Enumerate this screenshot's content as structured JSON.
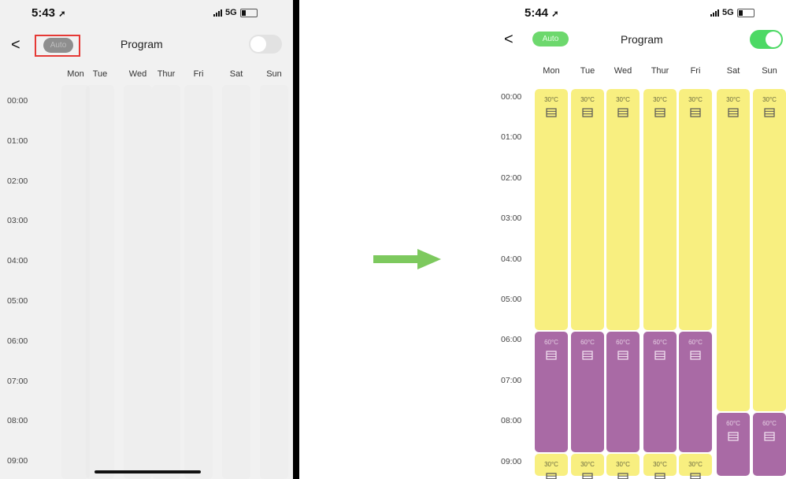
{
  "left_screen": {
    "status_time": "5:43",
    "network": "5G",
    "back_symbol": "<",
    "auto_label": "Auto",
    "title": "Program",
    "toggle_on": false,
    "days": [
      "Mon",
      "Tue",
      "Wed",
      "Thur",
      "Fri",
      "Sat",
      "Sun"
    ],
    "times": [
      "00:00",
      "01:00",
      "02:00",
      "03:00",
      "04:00",
      "05:00",
      "06:00",
      "07:00",
      "08:00",
      "09:00"
    ]
  },
  "right_screen": {
    "status_time": "5:44",
    "network": "5G",
    "back_symbol": "<",
    "auto_label": "Auto",
    "title": "Program",
    "toggle_on": true,
    "days": [
      "Mon",
      "Tue",
      "Wed",
      "Thur",
      "Fri",
      "Sat",
      "Sun"
    ],
    "times": [
      "00:00",
      "01:00",
      "02:00",
      "03:00",
      "04:00",
      "05:00",
      "06:00",
      "07:00",
      "08:00",
      "09:00"
    ],
    "schedule": [
      {
        "day": "Mon",
        "blocks": [
          {
            "start": 0,
            "end": 6,
            "temp": "30°C",
            "color": "yellow"
          },
          {
            "start": 6,
            "end": 9,
            "temp": "60°C",
            "color": "purple"
          },
          {
            "start": 9,
            "end": 9.6,
            "temp": "30°C",
            "color": "yellow"
          }
        ]
      },
      {
        "day": "Tue",
        "blocks": [
          {
            "start": 0,
            "end": 6,
            "temp": "30°C",
            "color": "yellow"
          },
          {
            "start": 6,
            "end": 9,
            "temp": "60°C",
            "color": "purple"
          },
          {
            "start": 9,
            "end": 9.6,
            "temp": "30°C",
            "color": "yellow"
          }
        ]
      },
      {
        "day": "Wed",
        "blocks": [
          {
            "start": 0,
            "end": 6,
            "temp": "30°C",
            "color": "yellow"
          },
          {
            "start": 6,
            "end": 9,
            "temp": "60°C",
            "color": "purple"
          },
          {
            "start": 9,
            "end": 9.6,
            "temp": "30°C",
            "color": "yellow"
          }
        ]
      },
      {
        "day": "Thur",
        "blocks": [
          {
            "start": 0,
            "end": 6,
            "temp": "30°C",
            "color": "yellow"
          },
          {
            "start": 6,
            "end": 9,
            "temp": "60°C",
            "color": "purple"
          },
          {
            "start": 9,
            "end": 9.6,
            "temp": "30°C",
            "color": "yellow"
          }
        ]
      },
      {
        "day": "Fri",
        "blocks": [
          {
            "start": 0,
            "end": 6,
            "temp": "30°C",
            "color": "yellow"
          },
          {
            "start": 6,
            "end": 9,
            "temp": "60°C",
            "color": "purple"
          },
          {
            "start": 9,
            "end": 9.6,
            "temp": "30°C",
            "color": "yellow"
          }
        ]
      },
      {
        "day": "Sat",
        "blocks": [
          {
            "start": 0,
            "end": 8,
            "temp": "30°C",
            "color": "yellow"
          },
          {
            "start": 8,
            "end": 9.6,
            "temp": "60°C",
            "color": "purple"
          }
        ]
      },
      {
        "day": "Sun",
        "blocks": [
          {
            "start": 0,
            "end": 8,
            "temp": "30°C",
            "color": "yellow"
          },
          {
            "start": 8,
            "end": 9.6,
            "temp": "60°C",
            "color": "purple"
          }
        ]
      }
    ]
  },
  "colors": {
    "yellow": "#f8ef80",
    "purple": "#a96aa5",
    "accent_green": "#6dd86d",
    "arrow_green": "#7dc95e",
    "highlight_red": "#e53935"
  },
  "icons": {
    "back": "chevron-left-icon",
    "heater": "heater-icon",
    "arrow": "arrow-right-icon",
    "location": "location-arrow-icon"
  }
}
